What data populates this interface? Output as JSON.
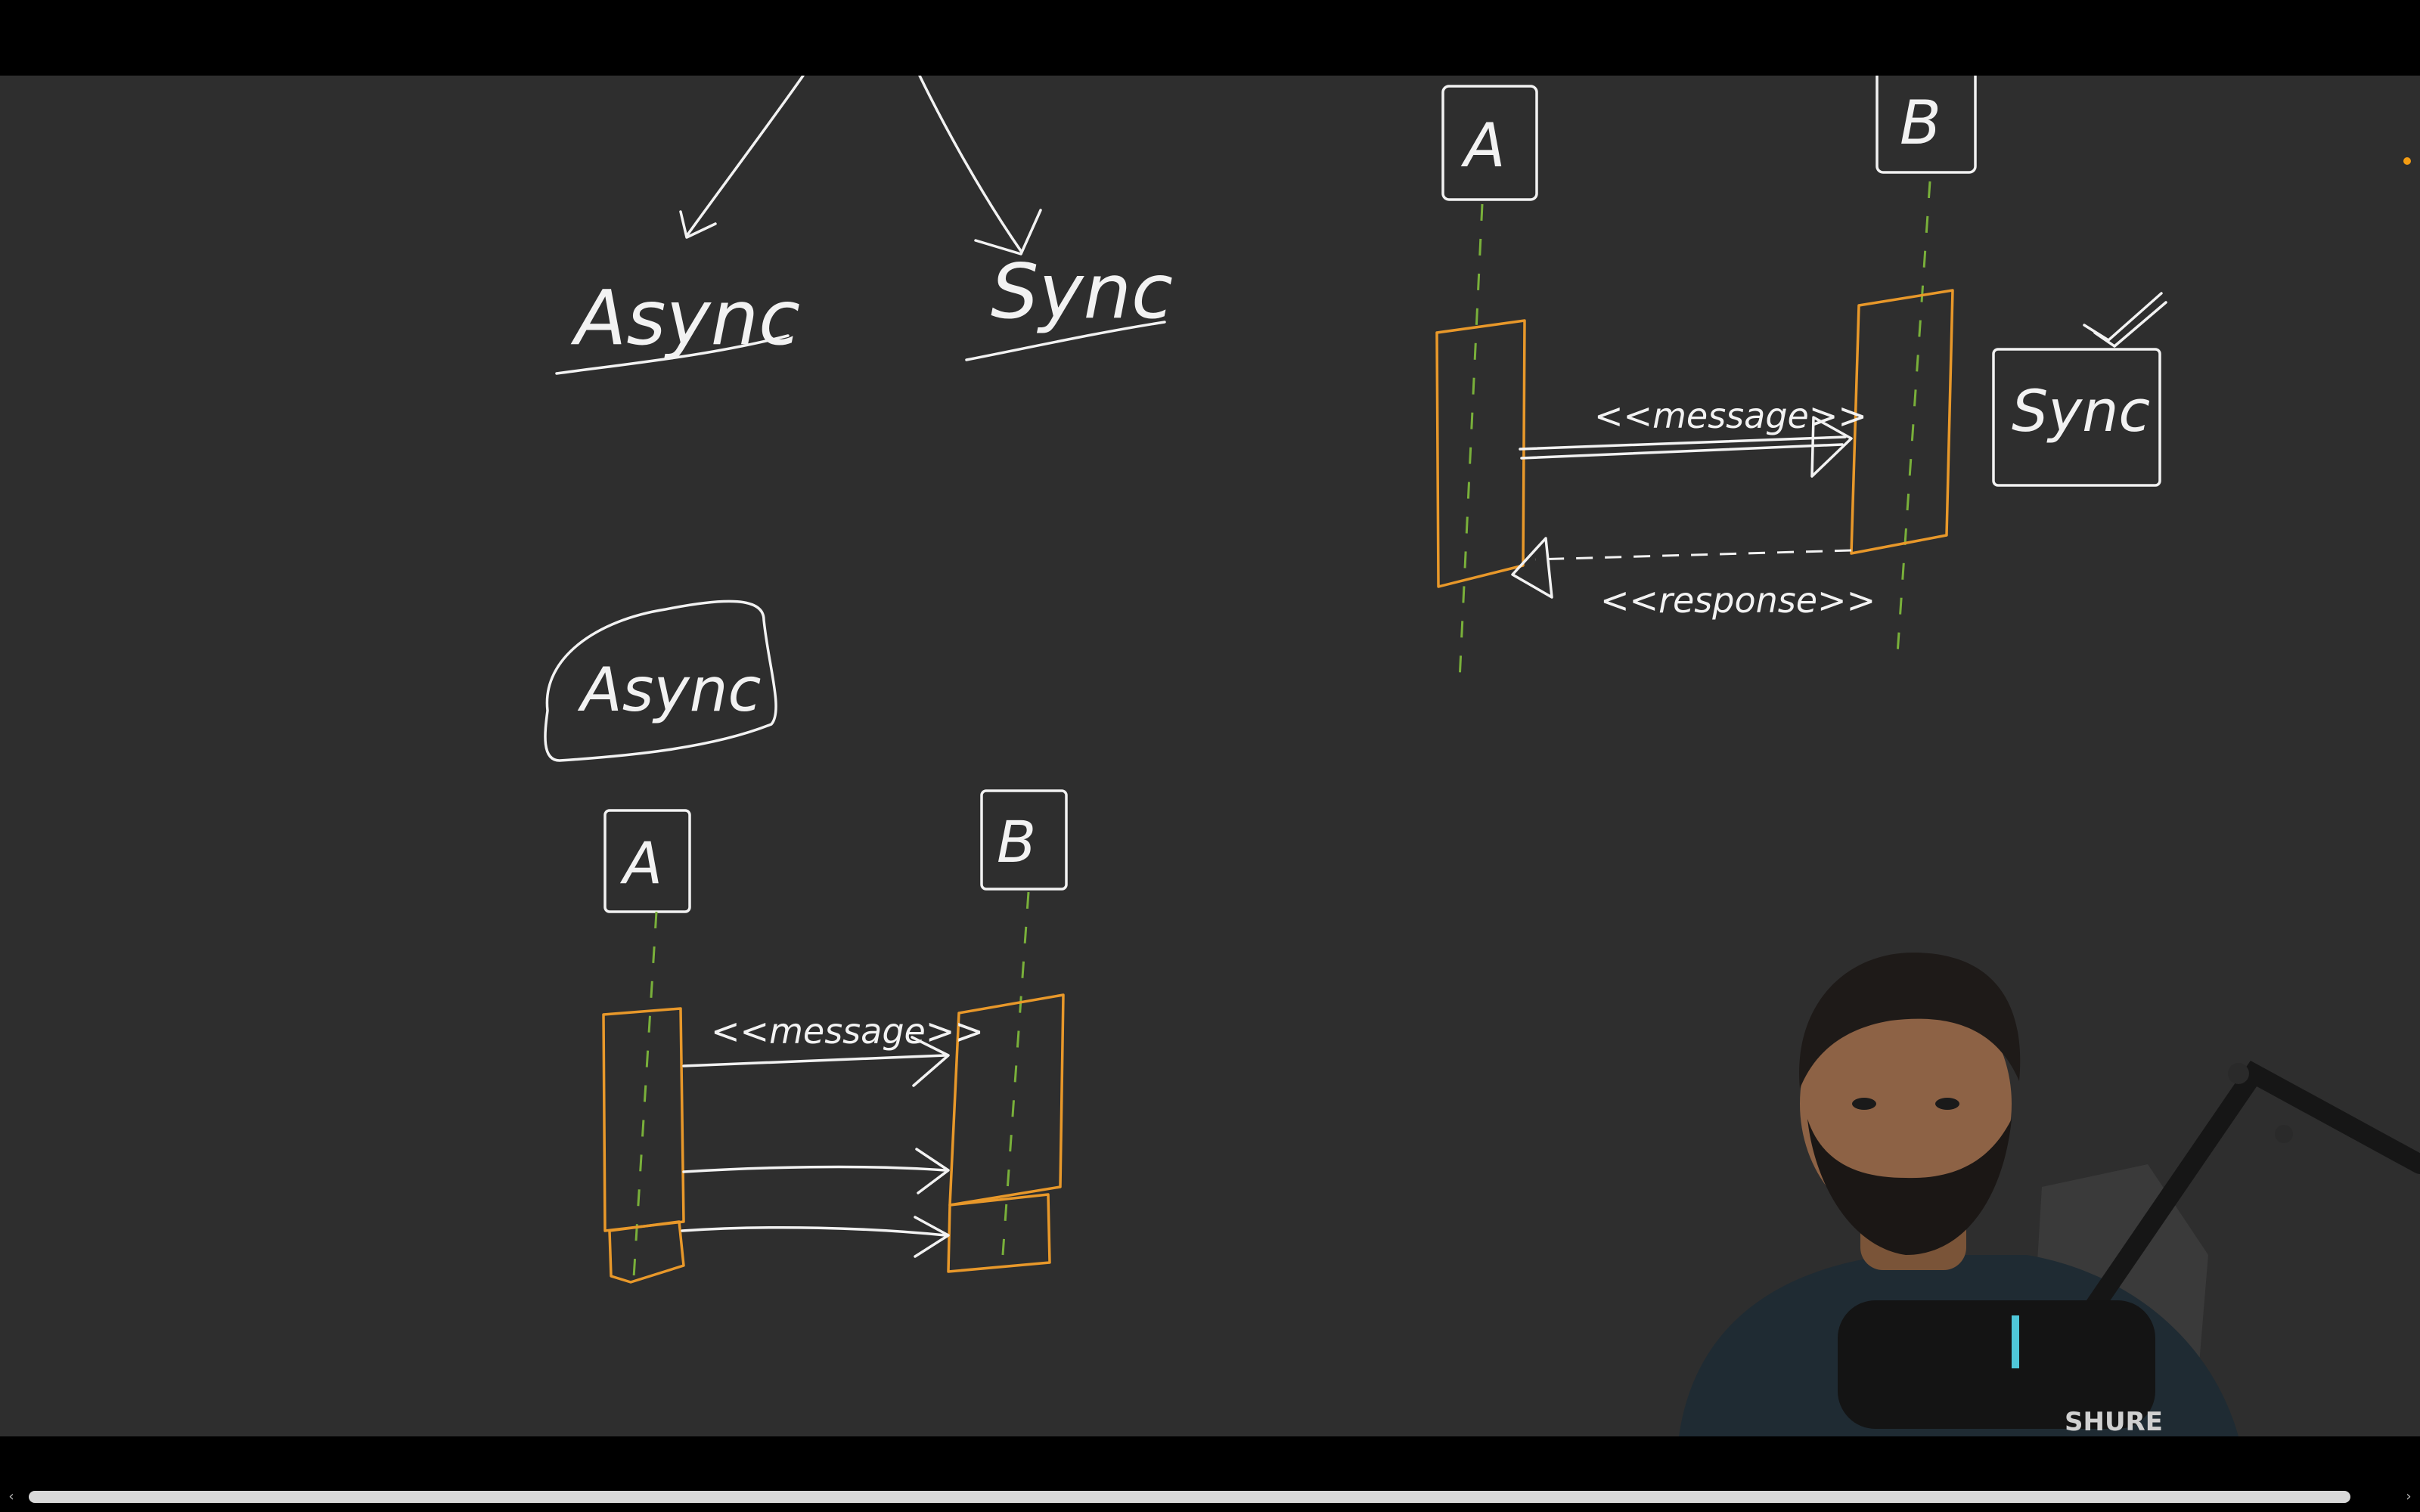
{
  "whiteboard": {
    "top_labels": {
      "async": "Async",
      "sync": "Sync"
    },
    "sync_diagram": {
      "participant_a": "A",
      "participant_b": "B",
      "message": "<<message>>",
      "response": "<<response>>",
      "tag": "Sync"
    },
    "async_diagram": {
      "tag": "Async",
      "participant_a": "A",
      "participant_b": "B",
      "message": "<<message>>"
    }
  },
  "presenter": {
    "mic_brand": "SHURE"
  },
  "colors": {
    "board_bg": "#2e2e2e",
    "ink": "#f2f2f2",
    "activation": "#e8982a",
    "lifeline": "#79b03a",
    "recording_dot": "#f39c12"
  }
}
